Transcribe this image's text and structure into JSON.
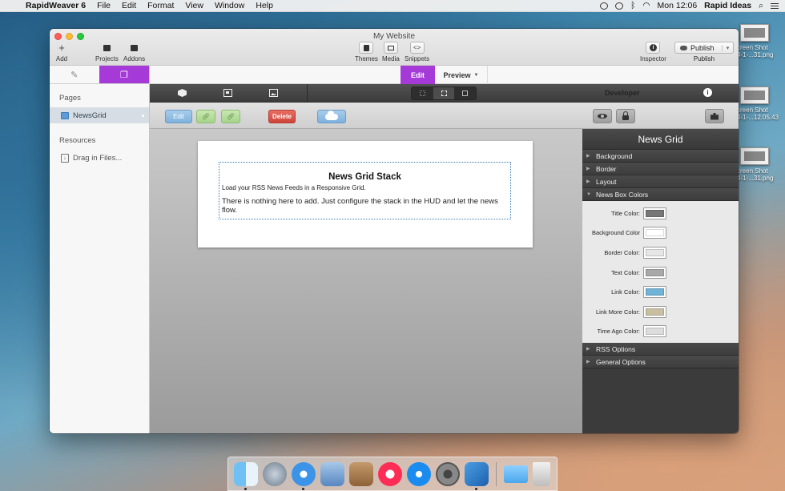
{
  "menubar": {
    "app_name": "RapidWeaver 6",
    "items": [
      "File",
      "Edit",
      "Format",
      "View",
      "Window",
      "Help"
    ],
    "clock": "Mon 12:06",
    "user": "Rapid Ideas",
    "apple_icon": "",
    "search_icon": "⌕"
  },
  "window": {
    "title": "My Website",
    "toolbar": {
      "add": "Add",
      "projects": "Projects",
      "addons": "Addons",
      "themes": "Themes",
      "media": "Media",
      "snippets": "Snippets",
      "inspector": "Inspector",
      "publish_button": "Publish",
      "publish_label": "Publish"
    }
  },
  "sidebar": {
    "pages_heading": "Pages",
    "page_item": "NewsGrid",
    "resources_heading": "Resources",
    "resources_item": "Drag in Files..."
  },
  "modes": {
    "edit": "Edit",
    "preview": "Preview"
  },
  "actions": {
    "edit": "Edit",
    "delete": "Delete"
  },
  "stack": {
    "title": "News Grid Stack",
    "description": "Load your RSS News Feeds in a Responsive Grid.",
    "note": "There is nothing here to add. Just configure the stack in the HUD and let the news flow."
  },
  "hud": {
    "developer": "Developer",
    "title": "News Grid",
    "sections_top": [
      "Background",
      "Border",
      "Layout"
    ],
    "open_section": "News Box Colors",
    "colors": [
      {
        "label": "Title Color:",
        "color": "#777777"
      },
      {
        "label": "Background Color",
        "color": "#ffffff"
      },
      {
        "label": "Border Color:",
        "color": "#e6e6e6"
      },
      {
        "label": "Text Color:",
        "color": "#a8a8a8"
      },
      {
        "label": "Link Color:",
        "color": "#6fb3d6"
      },
      {
        "label": "Link More Color:",
        "color": "#c8bfa0"
      },
      {
        "label": "Time Ago Color:",
        "color": "#dcdcdc"
      }
    ],
    "sections_bottom": [
      "RSS Options",
      "General Options"
    ]
  },
  "desktop": {
    "files": [
      "creen Shot",
      "4-1-...31.png",
      "creen Shot",
      "4-1-...12.05.43",
      "creen Shot",
      "4-1-...31.png"
    ]
  }
}
